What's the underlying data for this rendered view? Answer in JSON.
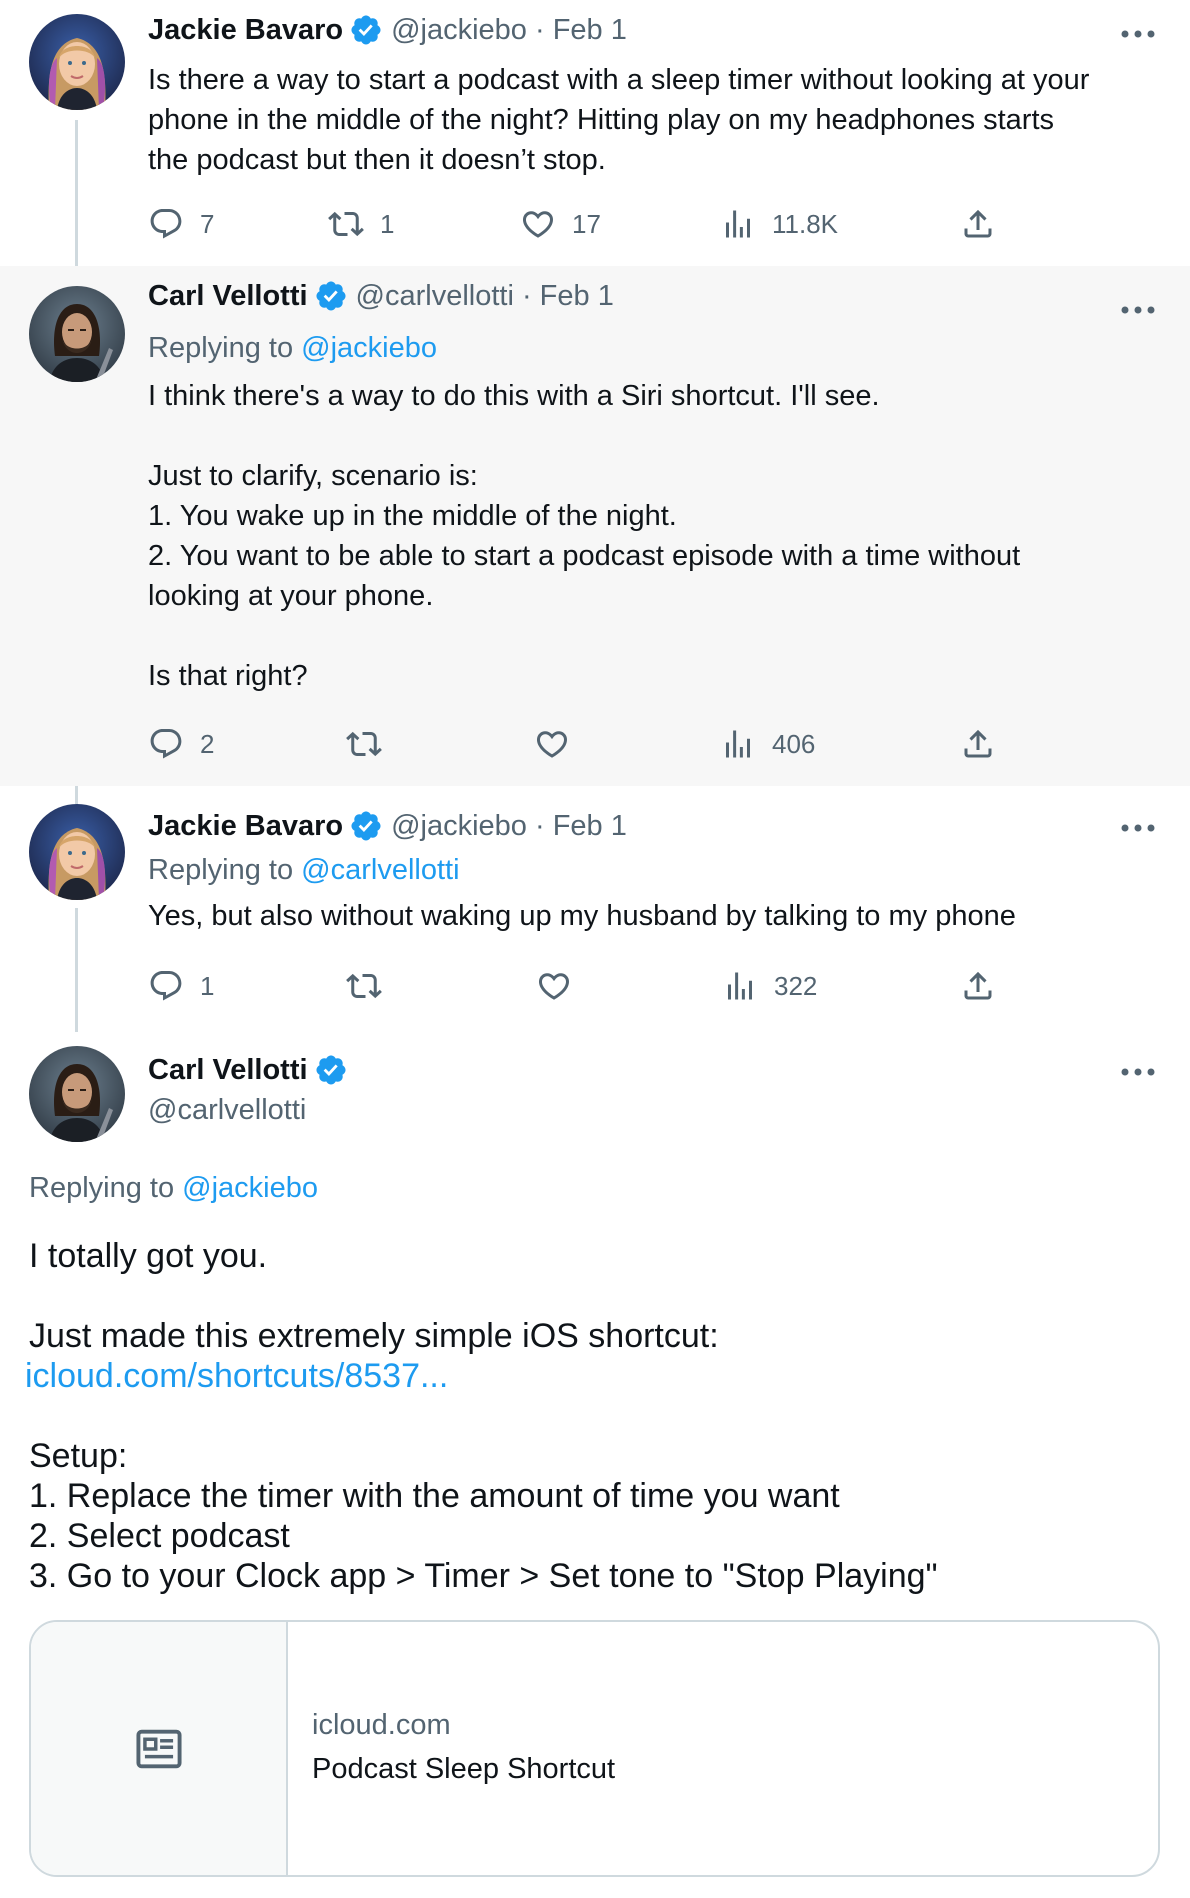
{
  "tweets": [
    {
      "name": "Jackie Bavaro",
      "handle": "@jackiebo · Feb 1",
      "replying_prefix": "",
      "replying_to": "",
      "text": [
        "Is there a way to start a podcast with a sleep timer without looking at your",
        "phone in the middle of the night? Hitting play on my headphones starts",
        "the podcast but then it doesn’t stop."
      ],
      "stats": {
        "replies": "7",
        "retweets": "1",
        "likes": "17",
        "views": "11.8K"
      }
    },
    {
      "name": "Carl Vellotti",
      "handle": "@carlvellotti · Feb 1",
      "replying_prefix": "Replying to ",
      "replying_to": "@jackiebo",
      "text": [
        "I think there's a way to do this with a Siri shortcut. I'll see.",
        "",
        "Just to clarify, scenario is:",
        "1. You wake up in the middle of the night.",
        "2. You want to be able to start a podcast episode with a time without",
        "looking at your phone.",
        "",
        "Is that right?"
      ],
      "stats": {
        "replies": "2",
        "retweets": "",
        "likes": "",
        "views": "406"
      }
    },
    {
      "name": "Jackie Bavaro",
      "handle": "@jackiebo · Feb 1",
      "replying_prefix": "Replying to ",
      "replying_to": "@carlvellotti",
      "text": [
        "Yes, but also without waking up my husband by talking to my phone"
      ],
      "stats": {
        "replies": "1",
        "retweets": "",
        "likes": "",
        "views": "322"
      }
    }
  ],
  "main": {
    "name": "Carl Vellotti",
    "handle": "@carlvellotti",
    "replying_prefix": "Replying to ",
    "replying_to": "@jackiebo",
    "text_1": "I totally got you.",
    "text_2": "Just made this extremely simple iOS shortcut:",
    "link": "icloud.com/shortcuts/8537...",
    "setup": [
      "Setup:",
      "1. Replace the timer with the amount of time you want",
      "2. Select podcast",
      "3. Go to your Clock app > Timer > Set tone to \"Stop Playing\""
    ],
    "card": {
      "domain": "icloud.com",
      "title": "Podcast Sleep Shortcut",
      "icon": "news-article-icon"
    }
  },
  "colors": {
    "accent": "#1d9bf0",
    "text": "#0f1419",
    "muted": "#536471",
    "shaded_bg": "#f7f7f7",
    "thread_line": "#cfd9de"
  },
  "icons": {
    "reply": "reply-icon",
    "retweet": "retweet-icon",
    "like": "heart-icon",
    "views": "views-chart-icon",
    "share": "share-icon",
    "more": "more-dots-icon",
    "verified": "verified-badge-icon"
  }
}
